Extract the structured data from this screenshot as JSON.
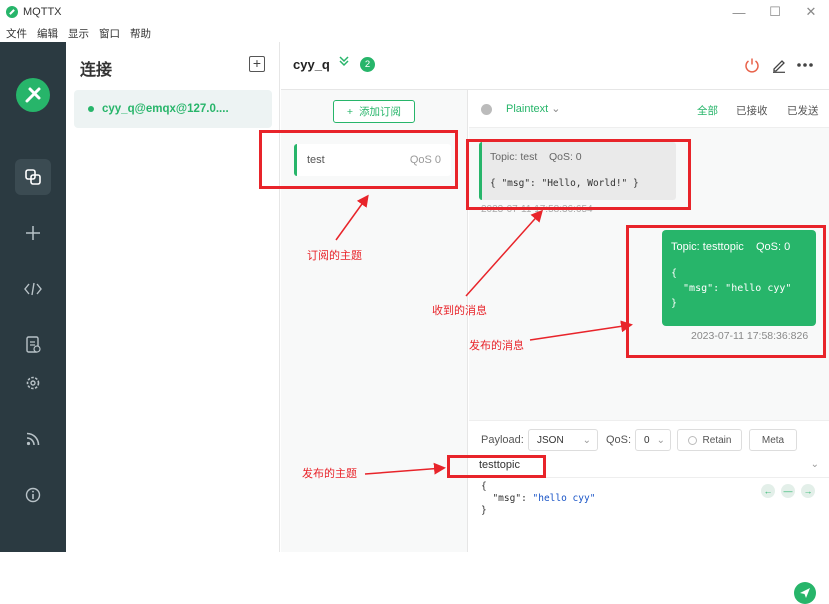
{
  "app": {
    "title": "MQTTX"
  },
  "menu": [
    "文件",
    "编辑",
    "显示",
    "窗口",
    "帮助"
  ],
  "connections": {
    "title": "连接",
    "items": [
      {
        "label": "cyy_q@emqx@127.0...."
      }
    ]
  },
  "header": {
    "name": "cyy_q",
    "badge": "2"
  },
  "subscriptions": {
    "add_label": "添加订阅",
    "items": [
      {
        "topic": "test",
        "qos": "QoS 0"
      }
    ]
  },
  "toolbar": {
    "payload_type": "Plaintext",
    "filters": [
      "全部",
      "已接收",
      "已发送"
    ]
  },
  "messages": {
    "received": {
      "topic": "Topic: test",
      "qos": "QoS: 0",
      "payload": "{ \"msg\": \"Hello, World!\" }",
      "time": "2023-07-11 17:58:36:654"
    },
    "sent": {
      "topic": "Topic: testtopic",
      "qos": "QoS: 0",
      "payload_lines": [
        "{",
        "  \"msg\": \"hello cyy\"",
        "}"
      ],
      "time": "2023-07-11 17:58:36:826"
    }
  },
  "publish": {
    "payload_label": "Payload:",
    "payload_format": "JSON",
    "qos_label": "QoS:",
    "qos_value": "0",
    "retain_label": "Retain",
    "meta_label": "Meta",
    "topic": "testtopic",
    "code_open": "{",
    "code_key": "\"msg\"",
    "code_sep": ": ",
    "code_value": "\"hello cyy\"",
    "code_close": "}"
  },
  "annotations": {
    "subscribed_topic": "订阅的主题",
    "received_message": "收到的消息",
    "published_message": "发布的消息",
    "published_topic": "发布的主题"
  },
  "colors": {
    "accent": "#27b56a",
    "sidebar": "#2b3a41",
    "annotation": "#e8242a"
  }
}
